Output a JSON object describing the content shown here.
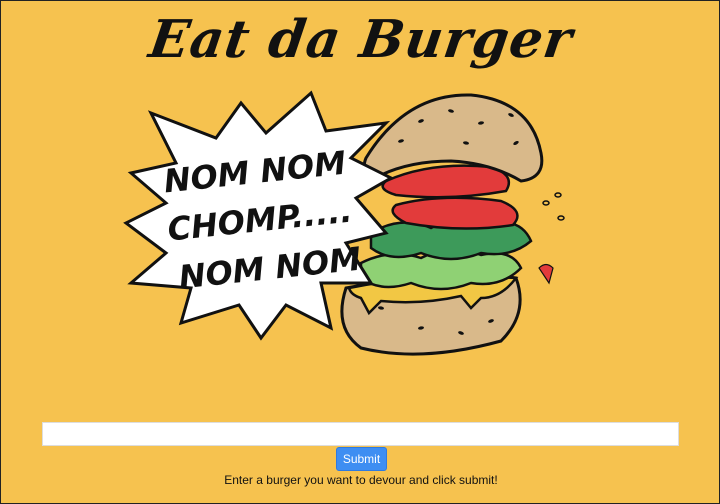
{
  "header": {
    "title": "Eat da Burger"
  },
  "hero": {
    "icon": "burger-nomnom-illustration",
    "bubble_lines": [
      "NOM NOM",
      "CHOMP.....",
      "NOM NOM"
    ]
  },
  "form": {
    "input_value": "",
    "submit_label": "Submit",
    "hint": "Enter a burger you want to devour and click submit!"
  },
  "colors": {
    "background": "#f6c24f",
    "button": "#3e8ef2",
    "bun": "#d9b98a",
    "tomato": "#e23b3b",
    "lettuce_dark": "#3d9a5a",
    "lettuce_light": "#8fd174",
    "cheese": "#f2c744"
  }
}
